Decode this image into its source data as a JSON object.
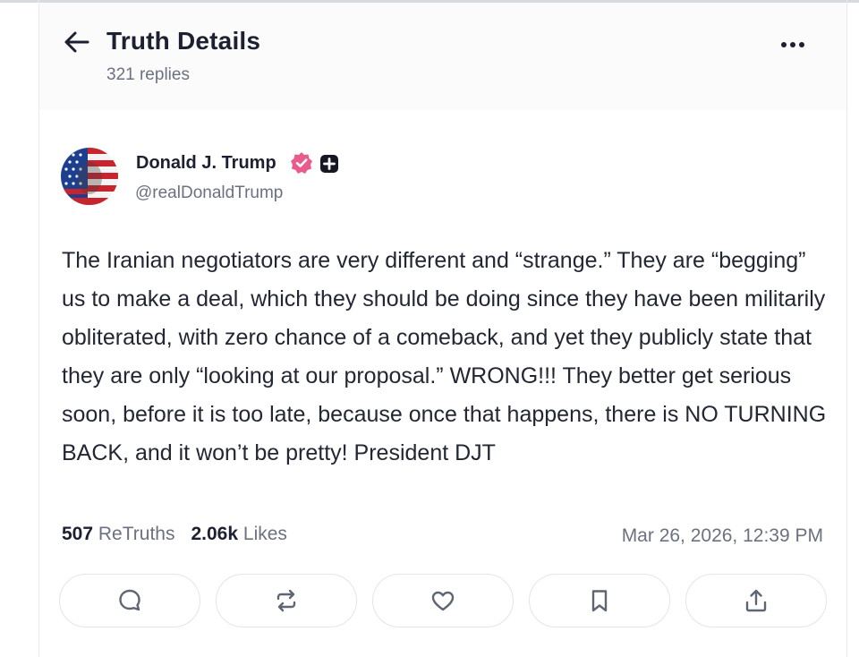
{
  "header": {
    "title": "Truth Details",
    "replies": "321 replies",
    "back_icon": "arrow-left-icon",
    "more_icon": "more-horizontal-icon"
  },
  "post": {
    "author_name": "Donald J. Trump",
    "handle": "@realDonaldTrump",
    "verified_color": "#ea5a8a",
    "text": "The Iranian negotiators are very different and “strange.” They are “begging” us to make a deal, which they should be doing since they have been militarily obliterated, with zero chance of a comeback, and yet they publicly state that they are only “looking at our proposal.” WRONG!!! They better get serious soon, before it is too late, because once that happens, there is NO TURNING BACK, and it won’t be pretty! President DJT",
    "retruths_count": "507",
    "retruths_label": "ReTruths",
    "likes_count": "2.06k",
    "likes_label": "Likes",
    "timestamp": "Mar 26, 2026, 12:39 PM"
  },
  "actions": [
    {
      "icon": "reply-icon"
    },
    {
      "icon": "retruth-icon"
    },
    {
      "icon": "like-icon"
    },
    {
      "icon": "bookmark-icon"
    },
    {
      "icon": "share-icon"
    }
  ]
}
